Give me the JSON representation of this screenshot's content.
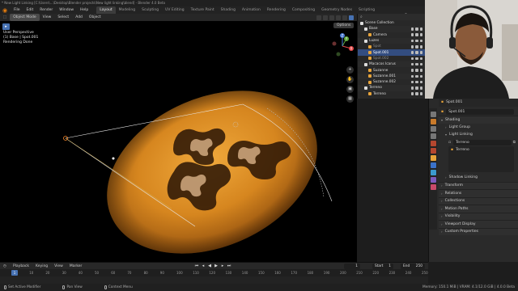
{
  "window": {
    "title": "* New Light Linking [C:\\Users\\...\\Desktop\\Blender projects\\New light linking\\blend] - Blender 4.0 Beta",
    "min": "—",
    "max": "☐",
    "close": "✕"
  },
  "menubar": {
    "items": [
      "File",
      "Edit",
      "Render",
      "Window",
      "Help"
    ],
    "workspaces": [
      "Layout",
      "Modeling",
      "Sculpting",
      "UV Editing",
      "Texture Paint",
      "Shading",
      "Animation",
      "Rendering",
      "Compositing",
      "Geometry Nodes",
      "Scripting"
    ],
    "active_workspace": "Layout",
    "scene_label": "Scene"
  },
  "viewport_header": {
    "mode": "Object Mode",
    "menus": [
      "View",
      "Select",
      "Add",
      "Object"
    ],
    "options": "Options"
  },
  "viewport": {
    "info_lines": [
      "User Perspective",
      "(1) Base | Spot.001",
      "Rendering Done"
    ],
    "gizmo_axes": {
      "x": "X",
      "y": "Y",
      "z": "Z"
    },
    "light_color": "#e89a2c"
  },
  "outliner": {
    "rows": [
      {
        "label": "Scene Collection",
        "indent": 0,
        "color": "#dddddd",
        "selected": false,
        "faded": false
      },
      {
        "label": "Base",
        "indent": 1,
        "color": "#dddddd",
        "selected": false,
        "faded": false
      },
      {
        "label": "Camera",
        "indent": 2,
        "color": "#dddddd",
        "selected": false,
        "faded": false
      },
      {
        "label": "Luzes",
        "indent": 1,
        "color": "#dddddd",
        "selected": false,
        "faded": false
      },
      {
        "label": "Spot",
        "indent": 2,
        "color": "#8a8a8a",
        "selected": false,
        "faded": true
      },
      {
        "label": "Spot.001",
        "indent": 2,
        "color": "#ffffff",
        "selected": true,
        "faded": false
      },
      {
        "label": "Spot.002",
        "indent": 2,
        "color": "#8a8a8a",
        "selected": false,
        "faded": true
      },
      {
        "label": "Macacos Icarus",
        "indent": 1,
        "color": "#dddddd",
        "selected": false,
        "faded": false
      },
      {
        "label": "Suzanne",
        "indent": 2,
        "color": "#dddddd",
        "selected": false,
        "faded": false
      },
      {
        "label": "Suzanne.001",
        "indent": 2,
        "color": "#dddddd",
        "selected": false,
        "faded": false
      },
      {
        "label": "Suzanne.002",
        "indent": 2,
        "color": "#dddddd",
        "selected": false,
        "faded": false
      },
      {
        "label": "Terreno",
        "indent": 1,
        "color": "#dddddd",
        "selected": false,
        "faded": false
      },
      {
        "label": "Terreno",
        "indent": 2,
        "color": "#dddddd",
        "selected": false,
        "faded": false
      }
    ]
  },
  "properties": {
    "breadcrumb": "Spot.001",
    "object_name": "Spot.001",
    "shading": "Shading",
    "light_group": "Light Group",
    "light_linking": "Light Linking",
    "collection_field": "Terreno",
    "collection_item": "Terreno",
    "shadow_linking": "Shadow Linking",
    "sections": [
      "Transform",
      "Relations",
      "Collections",
      "Motion Paths",
      "Visibility",
      "Viewport Display",
      "Custom Properties"
    ]
  },
  "timeline": {
    "menus": [
      "Playback",
      "Keying",
      "View",
      "Marker"
    ],
    "current_frame": "1",
    "start_label": "Start",
    "start": "1",
    "end_label": "End",
    "end": "250",
    "ticks": [
      "0",
      "10",
      "20",
      "30",
      "40",
      "50",
      "60",
      "70",
      "80",
      "90",
      "100",
      "110",
      "120",
      "130",
      "140",
      "150",
      "160",
      "170",
      "180",
      "190",
      "200",
      "210",
      "220",
      "230",
      "240",
      "250"
    ]
  },
  "statusbar": {
    "left": "Set Active Modifier",
    "middle": "Pan View",
    "right": "Context Menu",
    "stats": "Memory: 150.1 MiB | VRAM: 4.1/12.0 GiB | 4.0.0 Beta"
  }
}
